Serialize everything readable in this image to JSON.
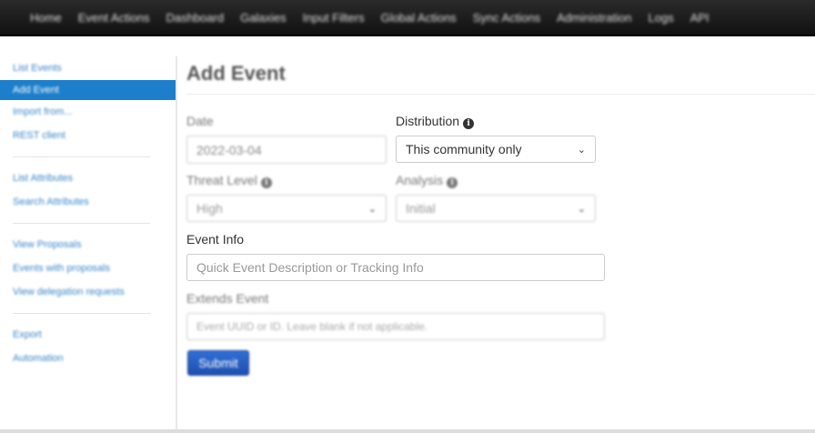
{
  "navbar": {
    "items": [
      "Home",
      "Event Actions",
      "Dashboard",
      "Galaxies",
      "Input Filters",
      "Global Actions",
      "Sync Actions",
      "Administration",
      "Logs",
      "API"
    ]
  },
  "sidebar": {
    "items": [
      {
        "label": "List Events"
      },
      {
        "label": "Add Event"
      },
      {
        "label": "Import from..."
      },
      {
        "label": "REST client"
      },
      {
        "label": "List Attributes"
      },
      {
        "label": "Search Attributes"
      },
      {
        "label": "View Proposals"
      },
      {
        "label": "Events with proposals"
      },
      {
        "label": "View delegation requests"
      },
      {
        "label": "Export"
      },
      {
        "label": "Automation"
      }
    ]
  },
  "main": {
    "title": "Add Event",
    "date": {
      "label": "Date",
      "value": "2022-03-04"
    },
    "distribution": {
      "label": "Distribution",
      "value": "This community only"
    },
    "threat_level": {
      "label": "Threat Level",
      "value": "High"
    },
    "analysis": {
      "label": "Analysis",
      "value": "Initial"
    },
    "event_info": {
      "label": "Event Info",
      "placeholder": "Quick Event Description or Tracking Info"
    },
    "extends_event": {
      "label": "Extends Event",
      "placeholder": "Event UUID or ID. Leave blank if not applicable."
    },
    "submit_label": "Submit"
  },
  "icons": {
    "info": "info-icon",
    "dropdown": "chevron-down-icon"
  },
  "colors": {
    "navbar": "#1a1a1a",
    "active_sidebar": "#1d7fcb",
    "link": "#3a87c8",
    "submit": "#2a62c9"
  }
}
